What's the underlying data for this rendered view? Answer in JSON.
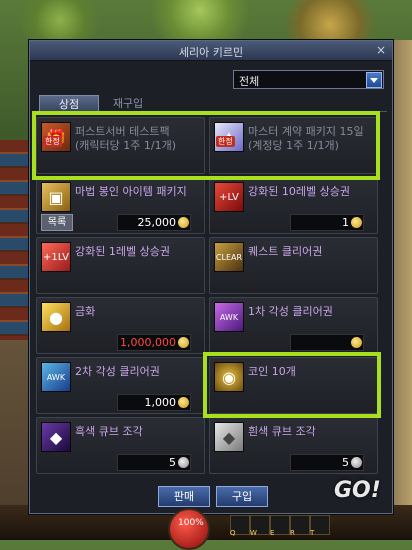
{
  "window": {
    "title": "세리아 키르민",
    "close": "×"
  },
  "filter": {
    "value": "전체"
  },
  "tabs": {
    "shop": "상점",
    "repurchase": "재구입"
  },
  "items": [
    {
      "name": "퍼스트서버 테스트팩",
      "sub": "(캐릭터당 1주 1/1개)",
      "badge": "한정",
      "price": "",
      "dim": true
    },
    {
      "name": "마스터 계약 패키지 15일",
      "sub": "(계정당 1주 1/1개)",
      "badge": "한정",
      "price": "",
      "dim": true
    },
    {
      "name": "마법 봉인 아이템 패키지",
      "sub": "",
      "badge": "목록",
      "price": "25,000"
    },
    {
      "name": "강화된 10레벨 상승권",
      "sub": "",
      "price": "1"
    },
    {
      "name": "강화된 1레벨 상승권",
      "sub": "",
      "price": ""
    },
    {
      "name": "퀘스트 클리어권",
      "sub": "",
      "price": ""
    },
    {
      "name": "금화",
      "sub": "",
      "price": "1,000,000",
      "price_red": true
    },
    {
      "name": "1차 각성 클리어권",
      "sub": "",
      "price": "",
      "price_red": true
    },
    {
      "name": "2차 각성 클리어권",
      "sub": "",
      "price": "1,000"
    },
    {
      "name": "코인 10개",
      "sub": "",
      "price": ""
    },
    {
      "name": "흑색 큐브 조각",
      "sub": "",
      "price": "5"
    },
    {
      "name": "흰색 큐브 조각",
      "sub": "",
      "price": "5"
    }
  ],
  "buttons": {
    "sell": "판매",
    "buy": "구입"
  },
  "hud": {
    "logo": "GO!",
    "hp": "100%",
    "keys": [
      "Q",
      "W",
      "E",
      "R",
      "T"
    ]
  }
}
